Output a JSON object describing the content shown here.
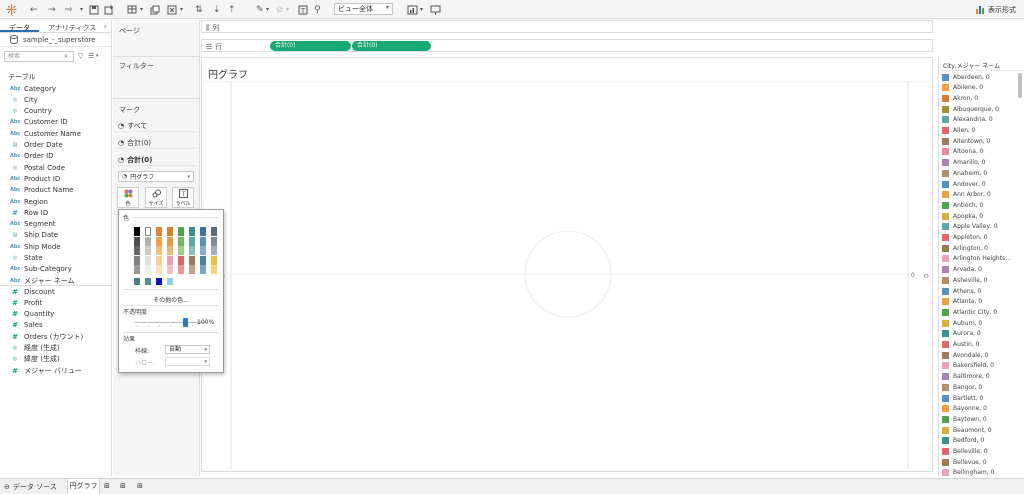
{
  "toolbar": {
    "view_select": "ビュー全体",
    "show_me": "表示形式"
  },
  "left_pane": {
    "tabs": [
      "データ",
      "アナリティクス"
    ],
    "datasource": "sample_-_superstore",
    "search_placeholder": "検索",
    "table_label": "テーブル",
    "dimensions": [
      {
        "type": "Abc",
        "name": "Category"
      },
      {
        "type": "globe",
        "name": "City"
      },
      {
        "type": "globe",
        "name": "Country"
      },
      {
        "type": "Abc",
        "name": "Customer ID"
      },
      {
        "type": "Abc",
        "name": "Customer Name"
      },
      {
        "type": "date",
        "name": "Order Date"
      },
      {
        "type": "Abc",
        "name": "Order ID"
      },
      {
        "type": "globe",
        "name": "Postal Code"
      },
      {
        "type": "Abc",
        "name": "Product ID"
      },
      {
        "type": "Abc",
        "name": "Product Name"
      },
      {
        "type": "Abc",
        "name": "Region"
      },
      {
        "type": "#",
        "name": "Row ID"
      },
      {
        "type": "Abc",
        "name": "Segment"
      },
      {
        "type": "date",
        "name": "Ship Date"
      },
      {
        "type": "Abc",
        "name": "Ship Mode"
      },
      {
        "type": "globe",
        "name": "State"
      },
      {
        "type": "Abc",
        "name": "Sub-Category"
      },
      {
        "type": "Abc",
        "name": "メジャー ネーム"
      }
    ],
    "measures": [
      {
        "type": "#",
        "name": "Discount"
      },
      {
        "type": "#",
        "name": "Profit"
      },
      {
        "type": "#",
        "name": "Quantity"
      },
      {
        "type": "#",
        "name": "Sales"
      },
      {
        "type": "#",
        "name": "Orders (カウント)"
      },
      {
        "type": "globe",
        "name": "経度 (生成)"
      },
      {
        "type": "globe",
        "name": "緯度 (生成)"
      },
      {
        "type": "#",
        "name": "メジャー バリュー"
      }
    ]
  },
  "cards": {
    "pages": "ページ",
    "filters": "フィルター",
    "marks": "マーク",
    "marks_rows": [
      "すべて",
      "合計(0)",
      "合計(0)"
    ],
    "mark_type": "円グラフ",
    "mark_buttons": [
      "色",
      "サイズ",
      "ラベル"
    ]
  },
  "shelves": {
    "columns_label": "列",
    "rows_label": "行",
    "row_pills": [
      "合計(0)",
      "合計(0)"
    ]
  },
  "view": {
    "title": "円グラフ",
    "axis_zero_right": "0",
    "axis_zero_vertical": "0"
  },
  "color_popup": {
    "color_label": "色",
    "more_colors": "その他の色...",
    "opacity_label": "不透明度",
    "opacity_value": "100%",
    "opacity_percent": 100,
    "effects_label": "効果",
    "border_label": "枠線:",
    "border_value": "自動",
    "halo_label": "ハロー:",
    "palette_columns": [
      [
        "#000000",
        "#4d4d4d",
        "#666666",
        "#808080",
        "#999999"
      ],
      [
        "#ffffff",
        "#b3b3b3",
        "#cccccc",
        "#e0e0e0",
        "#eeeeee"
      ],
      [
        "#e2813a",
        "#f0a040",
        "#f5bc72",
        "#f7cf9b",
        "#fae0bd"
      ],
      [
        "#d9802e",
        "#e39c4e",
        "#eab679",
        "#e8a3b0",
        "#f0c2ca"
      ],
      [
        "#51a152",
        "#72b566",
        "#a1cc8d",
        "#d46a6a",
        "#e89696"
      ],
      [
        "#3c8f8a",
        "#5ca8a2",
        "#86bfbb",
        "#9b7a5d",
        "#c2a287"
      ],
      [
        "#3d6fa3",
        "#5b8dbf",
        "#86add4",
        "#4e7f9b",
        "#7aa4bd"
      ],
      [
        "#5b6b7a",
        "#7d8a97",
        "#a4aeb8",
        "#e6c24a",
        "#f1d77d"
      ]
    ],
    "recent_colors": [
      "#4e7f86",
      "#4f8e8e",
      "#1010c8",
      "#8ecbe8"
    ]
  },
  "legend": {
    "title": "City,メジャー ネーム",
    "items": [
      {
        "label": "Aberdeen, 0",
        "color": "#5b8dbf"
      },
      {
        "label": "Abilene, 0",
        "color": "#f0a040"
      },
      {
        "label": "Akron, 0",
        "color": "#d9802e"
      },
      {
        "label": "Albuquerque, 0",
        "color": "#a0922d"
      },
      {
        "label": "Alexandria, 0",
        "color": "#5ca8a2"
      },
      {
        "label": "Allen, 0",
        "color": "#e06a6a"
      },
      {
        "label": "Allentown, 0",
        "color": "#9b7a5d"
      },
      {
        "label": "Altoona, 0",
        "color": "#e88aa8"
      },
      {
        "label": "Amarillo, 0",
        "color": "#a884b0"
      },
      {
        "label": "Anaheim, 0",
        "color": "#b0906e"
      },
      {
        "label": "Andover, 0",
        "color": "#5b8dbf"
      },
      {
        "label": "Ann Arbor, 0",
        "color": "#f0a040"
      },
      {
        "label": "Antioch, 0",
        "color": "#51a152"
      },
      {
        "label": "Apopka, 0",
        "color": "#d4b13a"
      },
      {
        "label": "Apple Valley, 0",
        "color": "#5ca8a2"
      },
      {
        "label": "Appleton, 0",
        "color": "#e06a6a"
      },
      {
        "label": "Arlington, 0",
        "color": "#9b7a5d"
      },
      {
        "label": "Arlington Heights...",
        "color": "#e8a3c0"
      },
      {
        "label": "Arvada, 0",
        "color": "#a884b0"
      },
      {
        "label": "Asheville, 0",
        "color": "#b0906e"
      },
      {
        "label": "Athens, 0",
        "color": "#5b8dbf"
      },
      {
        "label": "Atlanta, 0",
        "color": "#f0a040"
      },
      {
        "label": "Atlantic City, 0",
        "color": "#51a152"
      },
      {
        "label": "Auburn, 0",
        "color": "#d4b13a"
      },
      {
        "label": "Aurora, 0",
        "color": "#3c8f8a"
      },
      {
        "label": "Austin, 0",
        "color": "#e06a6a"
      },
      {
        "label": "Avondale, 0",
        "color": "#9b7a5d"
      },
      {
        "label": "Bakersfield, 0",
        "color": "#e8a3c0"
      },
      {
        "label": "Baltimore, 0",
        "color": "#a884b0"
      },
      {
        "label": "Bangor, 0",
        "color": "#b0906e"
      },
      {
        "label": "Bartlett, 0",
        "color": "#5b8dbf"
      },
      {
        "label": "Bayonne, 0",
        "color": "#f0a040"
      },
      {
        "label": "Baytown, 0",
        "color": "#51a152"
      },
      {
        "label": "Beaumont, 0",
        "color": "#d4b13a"
      },
      {
        "label": "Bedford, 0",
        "color": "#3c8f8a"
      },
      {
        "label": "Belleville, 0",
        "color": "#e06a6a"
      },
      {
        "label": "Bellevue, 0",
        "color": "#9b7a5d"
      },
      {
        "label": "Bellingham, 0",
        "color": "#e8a3c0"
      }
    ]
  },
  "bottom_bar": {
    "datasource_tab": "データ ソース",
    "sheet_tab": "円グラフ"
  }
}
